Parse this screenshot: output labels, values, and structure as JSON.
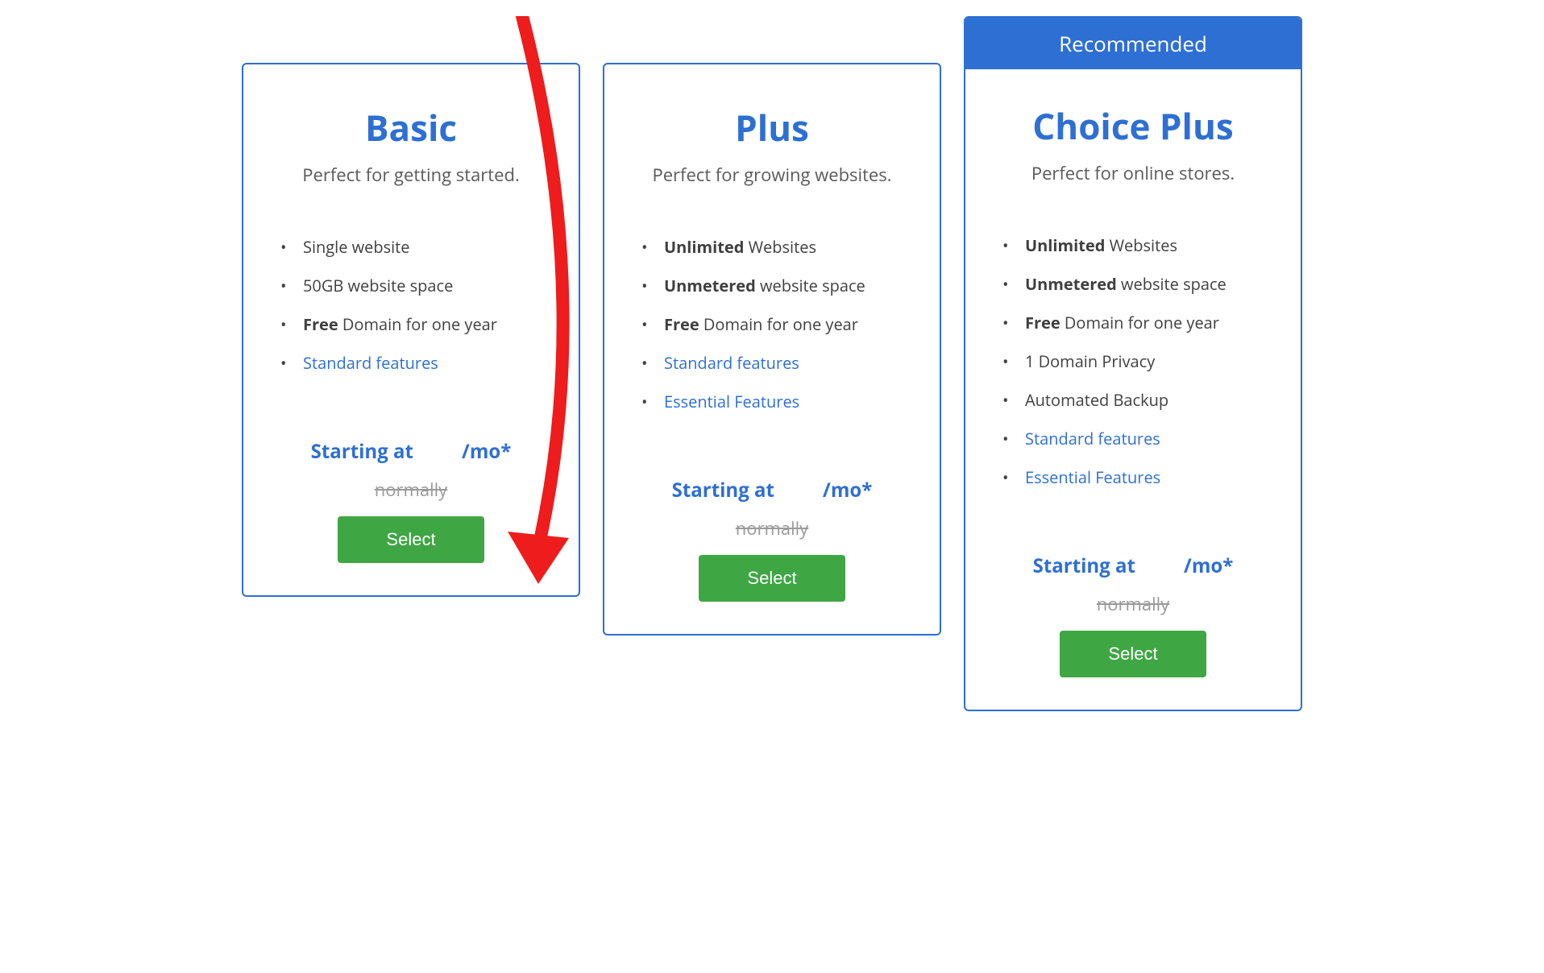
{
  "recommended_label": "Recommended",
  "plans": [
    {
      "title": "Basic",
      "subtitle": "Perfect for getting started.",
      "features": [
        {
          "bold": "",
          "rest": "Single website",
          "is_link": false
        },
        {
          "bold": "",
          "rest": "50GB website space",
          "is_link": false
        },
        {
          "bold": "Free",
          "rest": " Domain for one year",
          "is_link": false
        },
        {
          "bold": "",
          "rest": "Standard features",
          "is_link": true
        }
      ],
      "starting_at": "Starting at",
      "per_mo": "/mo*",
      "normally": "normally",
      "select": "Select"
    },
    {
      "title": "Plus",
      "subtitle": "Perfect for growing websites.",
      "features": [
        {
          "bold": "Unlimited",
          "rest": " Websites",
          "is_link": false
        },
        {
          "bold": "Unmetered",
          "rest": " website space",
          "is_link": false
        },
        {
          "bold": "Free",
          "rest": " Domain for one year",
          "is_link": false
        },
        {
          "bold": "",
          "rest": "Standard features",
          "is_link": true
        },
        {
          "bold": "",
          "rest": "Essential Features",
          "is_link": true
        }
      ],
      "starting_at": "Starting at",
      "per_mo": "/mo*",
      "normally": "normally",
      "select": "Select"
    },
    {
      "title": "Choice Plus",
      "subtitle": "Perfect for online stores.",
      "features": [
        {
          "bold": "Unlimited",
          "rest": " Websites",
          "is_link": false
        },
        {
          "bold": "Unmetered",
          "rest": " website space",
          "is_link": false
        },
        {
          "bold": "Free",
          "rest": " Domain for one year",
          "is_link": false
        },
        {
          "bold": "",
          "rest": "1 Domain Privacy",
          "is_link": false
        },
        {
          "bold": "",
          "rest": "Automated Backup",
          "is_link": false
        },
        {
          "bold": "",
          "rest": "Standard features",
          "is_link": true
        },
        {
          "bold": "",
          "rest": "Essential Features",
          "is_link": true
        }
      ],
      "starting_at": "Starting at",
      "per_mo": "/mo*",
      "normally": "normally",
      "select": "Select"
    }
  ],
  "colors": {
    "primary_blue": "#2e6fd3",
    "green_button": "#3fa644",
    "arrow_red": "#ee1c1c"
  }
}
